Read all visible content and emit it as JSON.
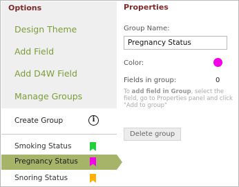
{
  "options": {
    "heading": "Options",
    "menu": [
      {
        "label": "Design Theme"
      },
      {
        "label": "Add Field"
      },
      {
        "label": "Add D4W Field"
      },
      {
        "label": "Manage Groups"
      }
    ],
    "create_group": {
      "label": "Create Group",
      "icon": "info-icon"
    }
  },
  "groups": [
    {
      "label": "Smoking Status",
      "color": "#1fd23c",
      "selected": false
    },
    {
      "label": "Pregnancy Status",
      "color": "#f200e9",
      "selected": true
    },
    {
      "label": "Snoring Status",
      "color": "#ffb000",
      "selected": false
    }
  ],
  "properties": {
    "heading": "Properties",
    "group_name_label": "Group Name:",
    "group_name_value": "Pregnancy Status",
    "color_label": "Color:",
    "color_value": "#f200e9",
    "fields_label": "Fields in group:",
    "fields_count": "0",
    "hint": {
      "prefix": "To ",
      "bold": "add field in Group",
      "suffix": ", select the field, go to Properties panel and click \"Add to group\""
    },
    "delete_label": "Delete group"
  }
}
